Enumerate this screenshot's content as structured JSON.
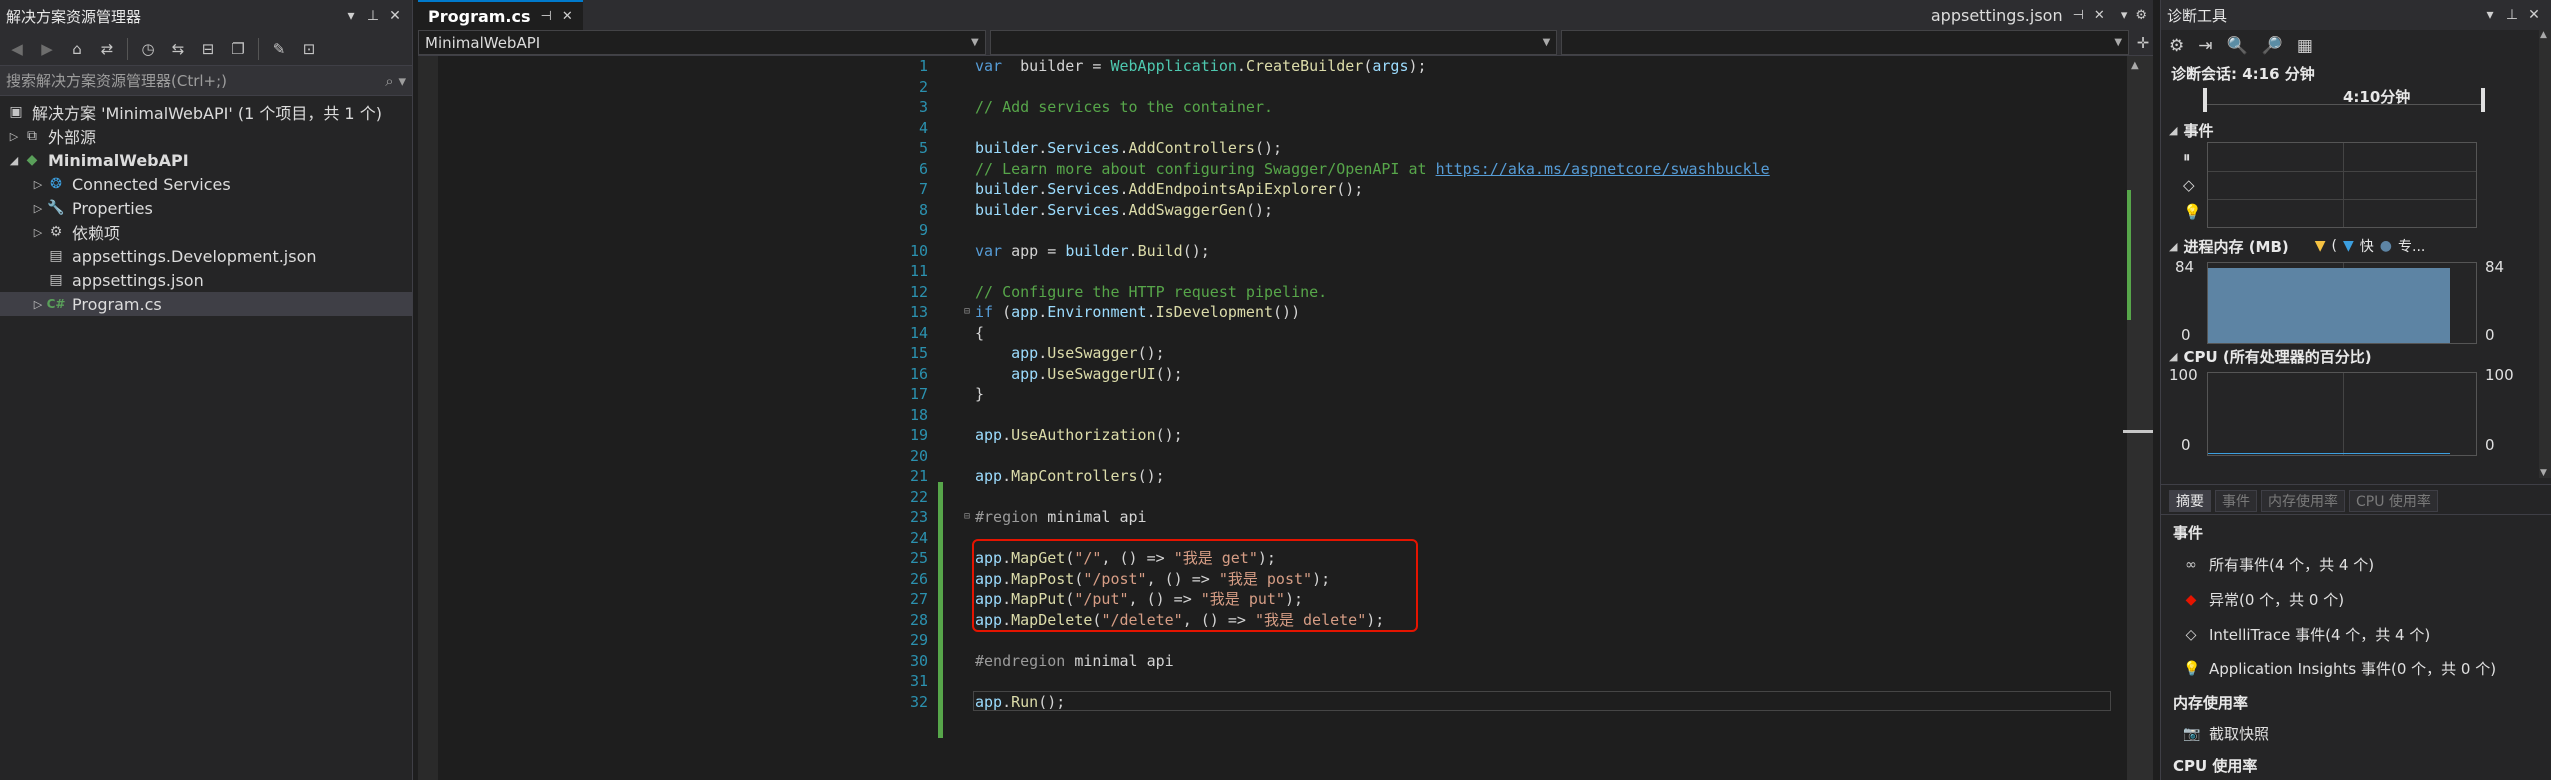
{
  "solution_explorer": {
    "title": "解决方案资源管理器",
    "search_placeholder": "搜索解决方案资源管理器(Ctrl+;)",
    "tree": [
      {
        "label": "解决方案 'MinimalWebAPI' (1 个项目，共 1 个)",
        "icon": "solution-icon"
      },
      {
        "label": "外部源",
        "icon": "external-sources-icon"
      },
      {
        "label": "MinimalWebAPI",
        "icon": "csharp-project-icon"
      },
      {
        "label": "Connected Services",
        "icon": "connected-services-icon"
      },
      {
        "label": "Properties",
        "icon": "properties-icon"
      },
      {
        "label": "依赖项",
        "icon": "dependencies-icon"
      },
      {
        "label": "appsettings.Development.json",
        "icon": "json-file-icon"
      },
      {
        "label": "appsettings.json",
        "icon": "json-file-icon"
      },
      {
        "label": "Program.cs",
        "icon": "csharp-file-icon"
      }
    ]
  },
  "editor": {
    "tabs": [
      {
        "label": "Program.cs",
        "active": true
      },
      {
        "label": "appsettings.json",
        "active": false
      }
    ],
    "nav_project": "MinimalWebAPI",
    "nav_type": "",
    "nav_member": "",
    "lines": [
      {
        "n": "1",
        "t": [
          [
            "kw",
            "var"
          ],
          [
            "",
            "  builder = "
          ],
          [
            "ty",
            "WebApplication"
          ],
          [
            "",
            "."
          ],
          [
            "fn",
            "CreateBuilder"
          ],
          [
            "",
            "("
          ],
          [
            "va",
            "args"
          ],
          [
            "",
            ");"
          ]
        ]
      },
      {
        "n": "2",
        "t": []
      },
      {
        "n": "3",
        "t": [
          [
            "cm",
            "// Add services to the container."
          ]
        ]
      },
      {
        "n": "4",
        "t": []
      },
      {
        "n": "5",
        "t": [
          [
            "va",
            "builder"
          ],
          [
            "",
            "."
          ],
          [
            "va",
            "Services"
          ],
          [
            "",
            "."
          ],
          [
            "fn",
            "AddControllers"
          ],
          [
            "",
            "();"
          ]
        ]
      },
      {
        "n": "6",
        "t": [
          [
            "cm",
            "// Learn more about configuring Swagger/OpenAPI at "
          ],
          [
            "lk",
            "https://aka.ms/aspnetcore/swashbuckle"
          ]
        ]
      },
      {
        "n": "7",
        "t": [
          [
            "va",
            "builder"
          ],
          [
            "",
            "."
          ],
          [
            "va",
            "Services"
          ],
          [
            "",
            "."
          ],
          [
            "fn",
            "AddEndpointsApiExplorer"
          ],
          [
            "",
            "();"
          ]
        ]
      },
      {
        "n": "8",
        "t": [
          [
            "va",
            "builder"
          ],
          [
            "",
            "."
          ],
          [
            "va",
            "Services"
          ],
          [
            "",
            "."
          ],
          [
            "fn",
            "AddSwaggerGen"
          ],
          [
            "",
            "();"
          ]
        ]
      },
      {
        "n": "9",
        "t": []
      },
      {
        "n": "10",
        "t": [
          [
            "kw",
            "var"
          ],
          [
            "",
            " app = "
          ],
          [
            "va",
            "builder"
          ],
          [
            "",
            "."
          ],
          [
            "fn",
            "Build"
          ],
          [
            "",
            "();"
          ]
        ]
      },
      {
        "n": "11",
        "t": []
      },
      {
        "n": "12",
        "t": [
          [
            "cm",
            "// Configure the HTTP request pipeline."
          ]
        ]
      },
      {
        "n": "13",
        "t": [
          [
            "kw",
            "if"
          ],
          [
            "",
            " ("
          ],
          [
            "va",
            "app"
          ],
          [
            "",
            "."
          ],
          [
            "va",
            "Environment"
          ],
          [
            "",
            "."
          ],
          [
            "fn",
            "IsDevelopment"
          ],
          [
            "",
            "())"
          ]
        ]
      },
      {
        "n": "14",
        "t": [
          [
            "",
            "{"
          ]
        ]
      },
      {
        "n": "15",
        "t": [
          [
            "",
            "    "
          ],
          [
            "va",
            "app"
          ],
          [
            "",
            "."
          ],
          [
            "fn",
            "UseSwagger"
          ],
          [
            "",
            "();"
          ]
        ]
      },
      {
        "n": "16",
        "t": [
          [
            "",
            "    "
          ],
          [
            "va",
            "app"
          ],
          [
            "",
            "."
          ],
          [
            "fn",
            "UseSwaggerUI"
          ],
          [
            "",
            "();"
          ]
        ]
      },
      {
        "n": "17",
        "t": [
          [
            "",
            "}"
          ]
        ]
      },
      {
        "n": "18",
        "t": []
      },
      {
        "n": "19",
        "t": [
          [
            "va",
            "app"
          ],
          [
            "",
            "."
          ],
          [
            "fn",
            "UseAuthorization"
          ],
          [
            "",
            "();"
          ]
        ]
      },
      {
        "n": "20",
        "t": []
      },
      {
        "n": "21",
        "t": [
          [
            "va",
            "app"
          ],
          [
            "",
            "."
          ],
          [
            "fn",
            "MapControllers"
          ],
          [
            "",
            "();"
          ]
        ]
      },
      {
        "n": "22",
        "t": []
      },
      {
        "n": "23",
        "t": [
          [
            "pr",
            "#region"
          ],
          [
            "",
            " minimal api"
          ]
        ]
      },
      {
        "n": "24",
        "t": []
      },
      {
        "n": "25",
        "t": [
          [
            "va",
            "app"
          ],
          [
            "",
            "."
          ],
          [
            "fn",
            "MapGet"
          ],
          [
            "",
            "("
          ],
          [
            "st",
            "\"/\""
          ],
          [
            "",
            ", () => "
          ],
          [
            "st",
            "\"我是 get\""
          ],
          [
            "",
            ");"
          ]
        ]
      },
      {
        "n": "26",
        "t": [
          [
            "va",
            "app"
          ],
          [
            "",
            "."
          ],
          [
            "fn",
            "MapPost"
          ],
          [
            "",
            "("
          ],
          [
            "st",
            "\"/post\""
          ],
          [
            "",
            ", () => "
          ],
          [
            "st",
            "\"我是 post\""
          ],
          [
            "",
            ");"
          ]
        ]
      },
      {
        "n": "27",
        "t": [
          [
            "va",
            "app"
          ],
          [
            "",
            "."
          ],
          [
            "fn",
            "MapPut"
          ],
          [
            "",
            "("
          ],
          [
            "st",
            "\"/put\""
          ],
          [
            "",
            ", () => "
          ],
          [
            "st",
            "\"我是 put\""
          ],
          [
            "",
            ");"
          ]
        ]
      },
      {
        "n": "28",
        "t": [
          [
            "va",
            "app"
          ],
          [
            "",
            "."
          ],
          [
            "fn",
            "MapDelete"
          ],
          [
            "",
            "("
          ],
          [
            "st",
            "\"/delete\""
          ],
          [
            "",
            ", () => "
          ],
          [
            "st",
            "\"我是 delete\""
          ],
          [
            "",
            ");"
          ]
        ]
      },
      {
        "n": "29",
        "t": []
      },
      {
        "n": "30",
        "t": [
          [
            "pr",
            "#endregion"
          ],
          [
            "",
            " minimal api"
          ]
        ]
      },
      {
        "n": "31",
        "t": []
      },
      {
        "n": "32",
        "t": [
          [
            "va",
            "app"
          ],
          [
            "",
            "."
          ],
          [
            "fn",
            "Run"
          ],
          [
            "",
            "();"
          ]
        ]
      }
    ]
  },
  "diagnostics": {
    "title": "诊断工具",
    "session": "诊断会话: 4:16 分钟",
    "timeline_label": "4:10分钟",
    "events_title": "事件",
    "memory_title": "进程内存 (MB)",
    "memory_legend": [
      "(",
      "快",
      "专..."
    ],
    "memory_max": "84",
    "memory_min": "0",
    "memory_level": 84,
    "cpu_title": "CPU (所有处理器的百分比)",
    "cpu_max": "100",
    "cpu_min": "0",
    "tabs": [
      "摘要",
      "事件",
      "内存使用率",
      "CPU 使用率"
    ],
    "summary": {
      "events_header": "事件",
      "items": [
        {
          "label": "所有事件(4 个，共 4 个)",
          "icon": "all-events-icon"
        },
        {
          "label": "异常(0 个，共 0 个)",
          "icon": "exception-icon"
        },
        {
          "label": "IntelliTrace 事件(4 个，共 4 个)",
          "icon": "intellitrace-icon"
        },
        {
          "label": "Application Insights 事件(0 个，共 0 个)",
          "icon": "app-insights-icon"
        }
      ],
      "memory_header": "内存使用率",
      "snapshot_label": "截取快照",
      "cpu_header": "CPU 使用率"
    },
    "colors": {
      "accent": "#007acc",
      "memory_fill": "#5d84a4",
      "error_box": "#e51400"
    }
  }
}
